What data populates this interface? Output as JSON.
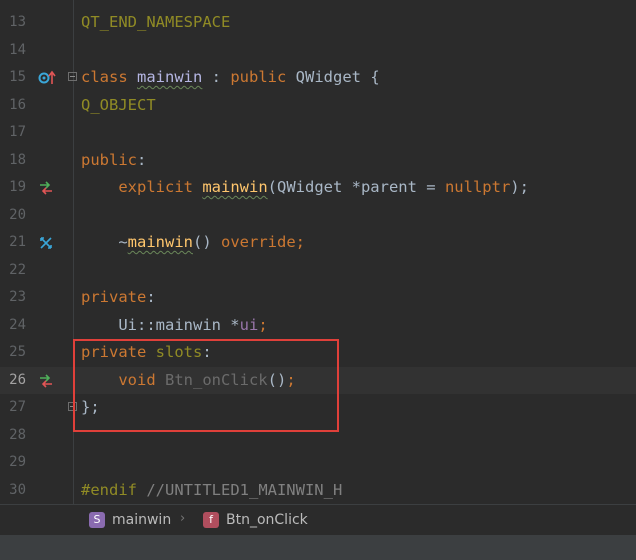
{
  "lines": [
    {
      "num": "13"
    },
    {
      "num": "14"
    },
    {
      "num": "15"
    },
    {
      "num": "16"
    },
    {
      "num": "17"
    },
    {
      "num": "18"
    },
    {
      "num": "19"
    },
    {
      "num": "20"
    },
    {
      "num": "21"
    },
    {
      "num": "22"
    },
    {
      "num": "23"
    },
    {
      "num": "24"
    },
    {
      "num": "25"
    },
    {
      "num": "26"
    },
    {
      "num": "27"
    },
    {
      "num": "28"
    },
    {
      "num": "29"
    },
    {
      "num": "30"
    }
  ],
  "code": {
    "l13": "QT_END_NAMESPACE",
    "l15_class": "class",
    "l15_name": "mainwin",
    "l15_colon": " : ",
    "l15_public": "public",
    "l15_base": " QWidget {",
    "l16": "Q_OBJECT",
    "l18_public": "public",
    "l18_colon": ":",
    "l19_explicit": "explicit",
    "l19_name": "mainwin",
    "l19_paren": "(QWidget *parent = ",
    "l19_nullptr": "nullptr",
    "l19_end": ");",
    "l21_tilde": "~",
    "l21_name": "mainwin",
    "l21_paren": "() ",
    "l21_override": "override",
    "l21_semi": ";",
    "l23_private": "private",
    "l23_colon": ":",
    "l24_ns": "Ui::mainwin *",
    "l24_var": "ui",
    "l24_semi": ";",
    "l25_private": "private",
    "l25_slots": " slots",
    "l25_colon": ":",
    "l26_void": "void",
    "l26_name": " Btn_onClick",
    "l26_paren": "()",
    "l26_semi": ";",
    "l27": "};",
    "l30_endif": "#endif",
    "l30_comment": " //UNTITLED1_MAINWIN_H"
  },
  "gutter_icons": {
    "l15": "override-up-icon",
    "l19": "navigate-definition-icon",
    "l21": "implemented-icon",
    "l26": "navigate-definition-icon"
  },
  "breadcrumb": {
    "items": [
      {
        "badge": "S",
        "label": "mainwin"
      },
      {
        "badge": "f",
        "label": "Btn_onClick"
      }
    ],
    "separator": "›"
  },
  "colors": {
    "background": "#2b2b2b",
    "keyword": "#cc7832",
    "macro": "#908b25",
    "function": "#ffc66d",
    "highlight_border": "#e0403a"
  }
}
